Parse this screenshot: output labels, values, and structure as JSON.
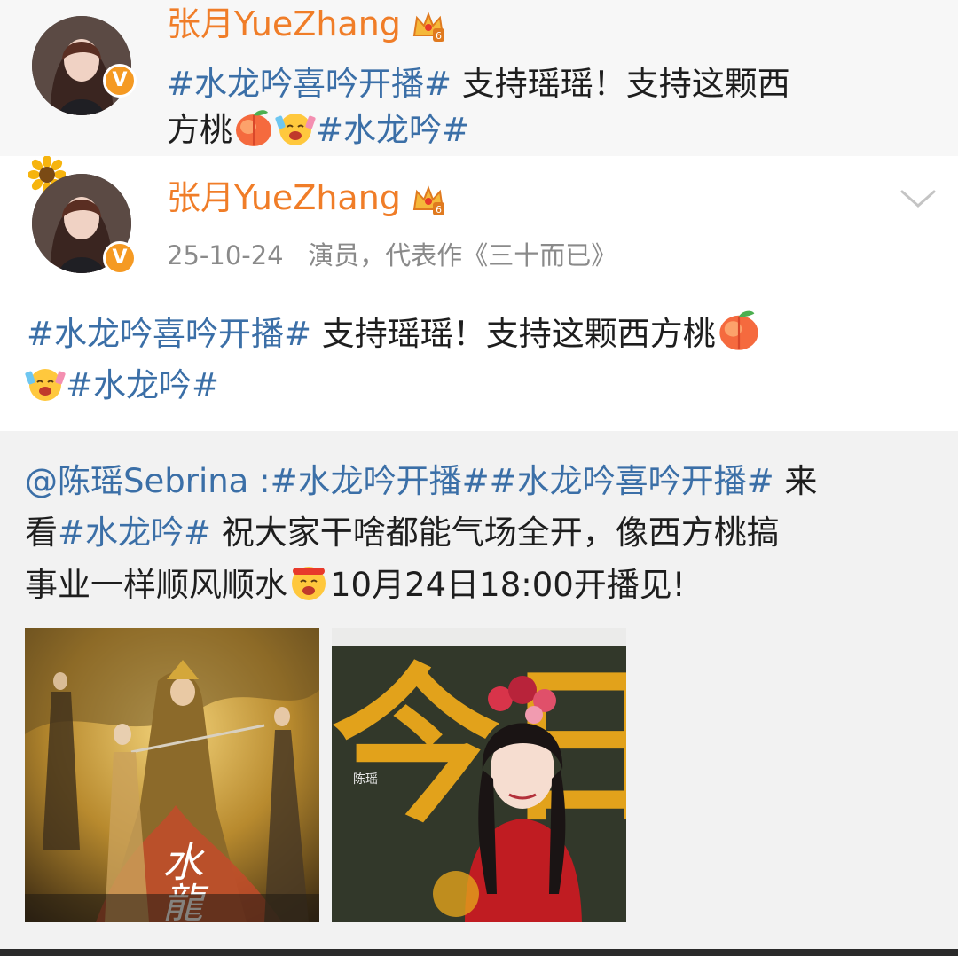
{
  "comment": {
    "username": "张月YueZhang",
    "line1_tag": "#水龙吟喜吟开播#",
    "line1_text": " 支持瑶瑶！支持这颗西",
    "line2_text": "方桃",
    "line2_tag": "#水龙吟#",
    "badge_level": "6"
  },
  "post": {
    "username": "张月YueZhang",
    "timestamp": "25-10-24",
    "bio": "演员，代表作《三十而已》",
    "badge_level": "6",
    "line1_tag": "#水龙吟喜吟开播#",
    "line1_text": " 支持瑶瑶！支持这颗西方桃",
    "line2_tag": "#水龙吟#"
  },
  "repost": {
    "mention": "@陈瑶Sebrina",
    "colon": " :",
    "tag1": "#水龙吟开播#",
    "tag2": "#水龙吟喜吟开播#",
    "l1_tail": " 来",
    "l2_head": "看",
    "tag3": "#水龙吟#",
    "l2_text": " 祝大家干啥都能气场全开，像西方桃搞",
    "l3_text": "事业一样顺风顺水",
    "l3_tail": "10月24日18:00开播见!",
    "poster1_title": "水龍吟",
    "poster2_bg_text": "今日",
    "poster2_name": "陈瑶"
  },
  "icons": {
    "verified": "verified-v-icon",
    "crown": "vip-crown-icon",
    "peach": "peach-emoji-icon",
    "cheer": "cheering-face-emoji-icon",
    "sunflower": "sunflower-icon",
    "chevron": "chevron-down-icon"
  },
  "colors": {
    "username": "#f07d28",
    "hashtag": "#3b6fa7",
    "meta": "#8a8a8a",
    "verified": "#f59a23"
  }
}
